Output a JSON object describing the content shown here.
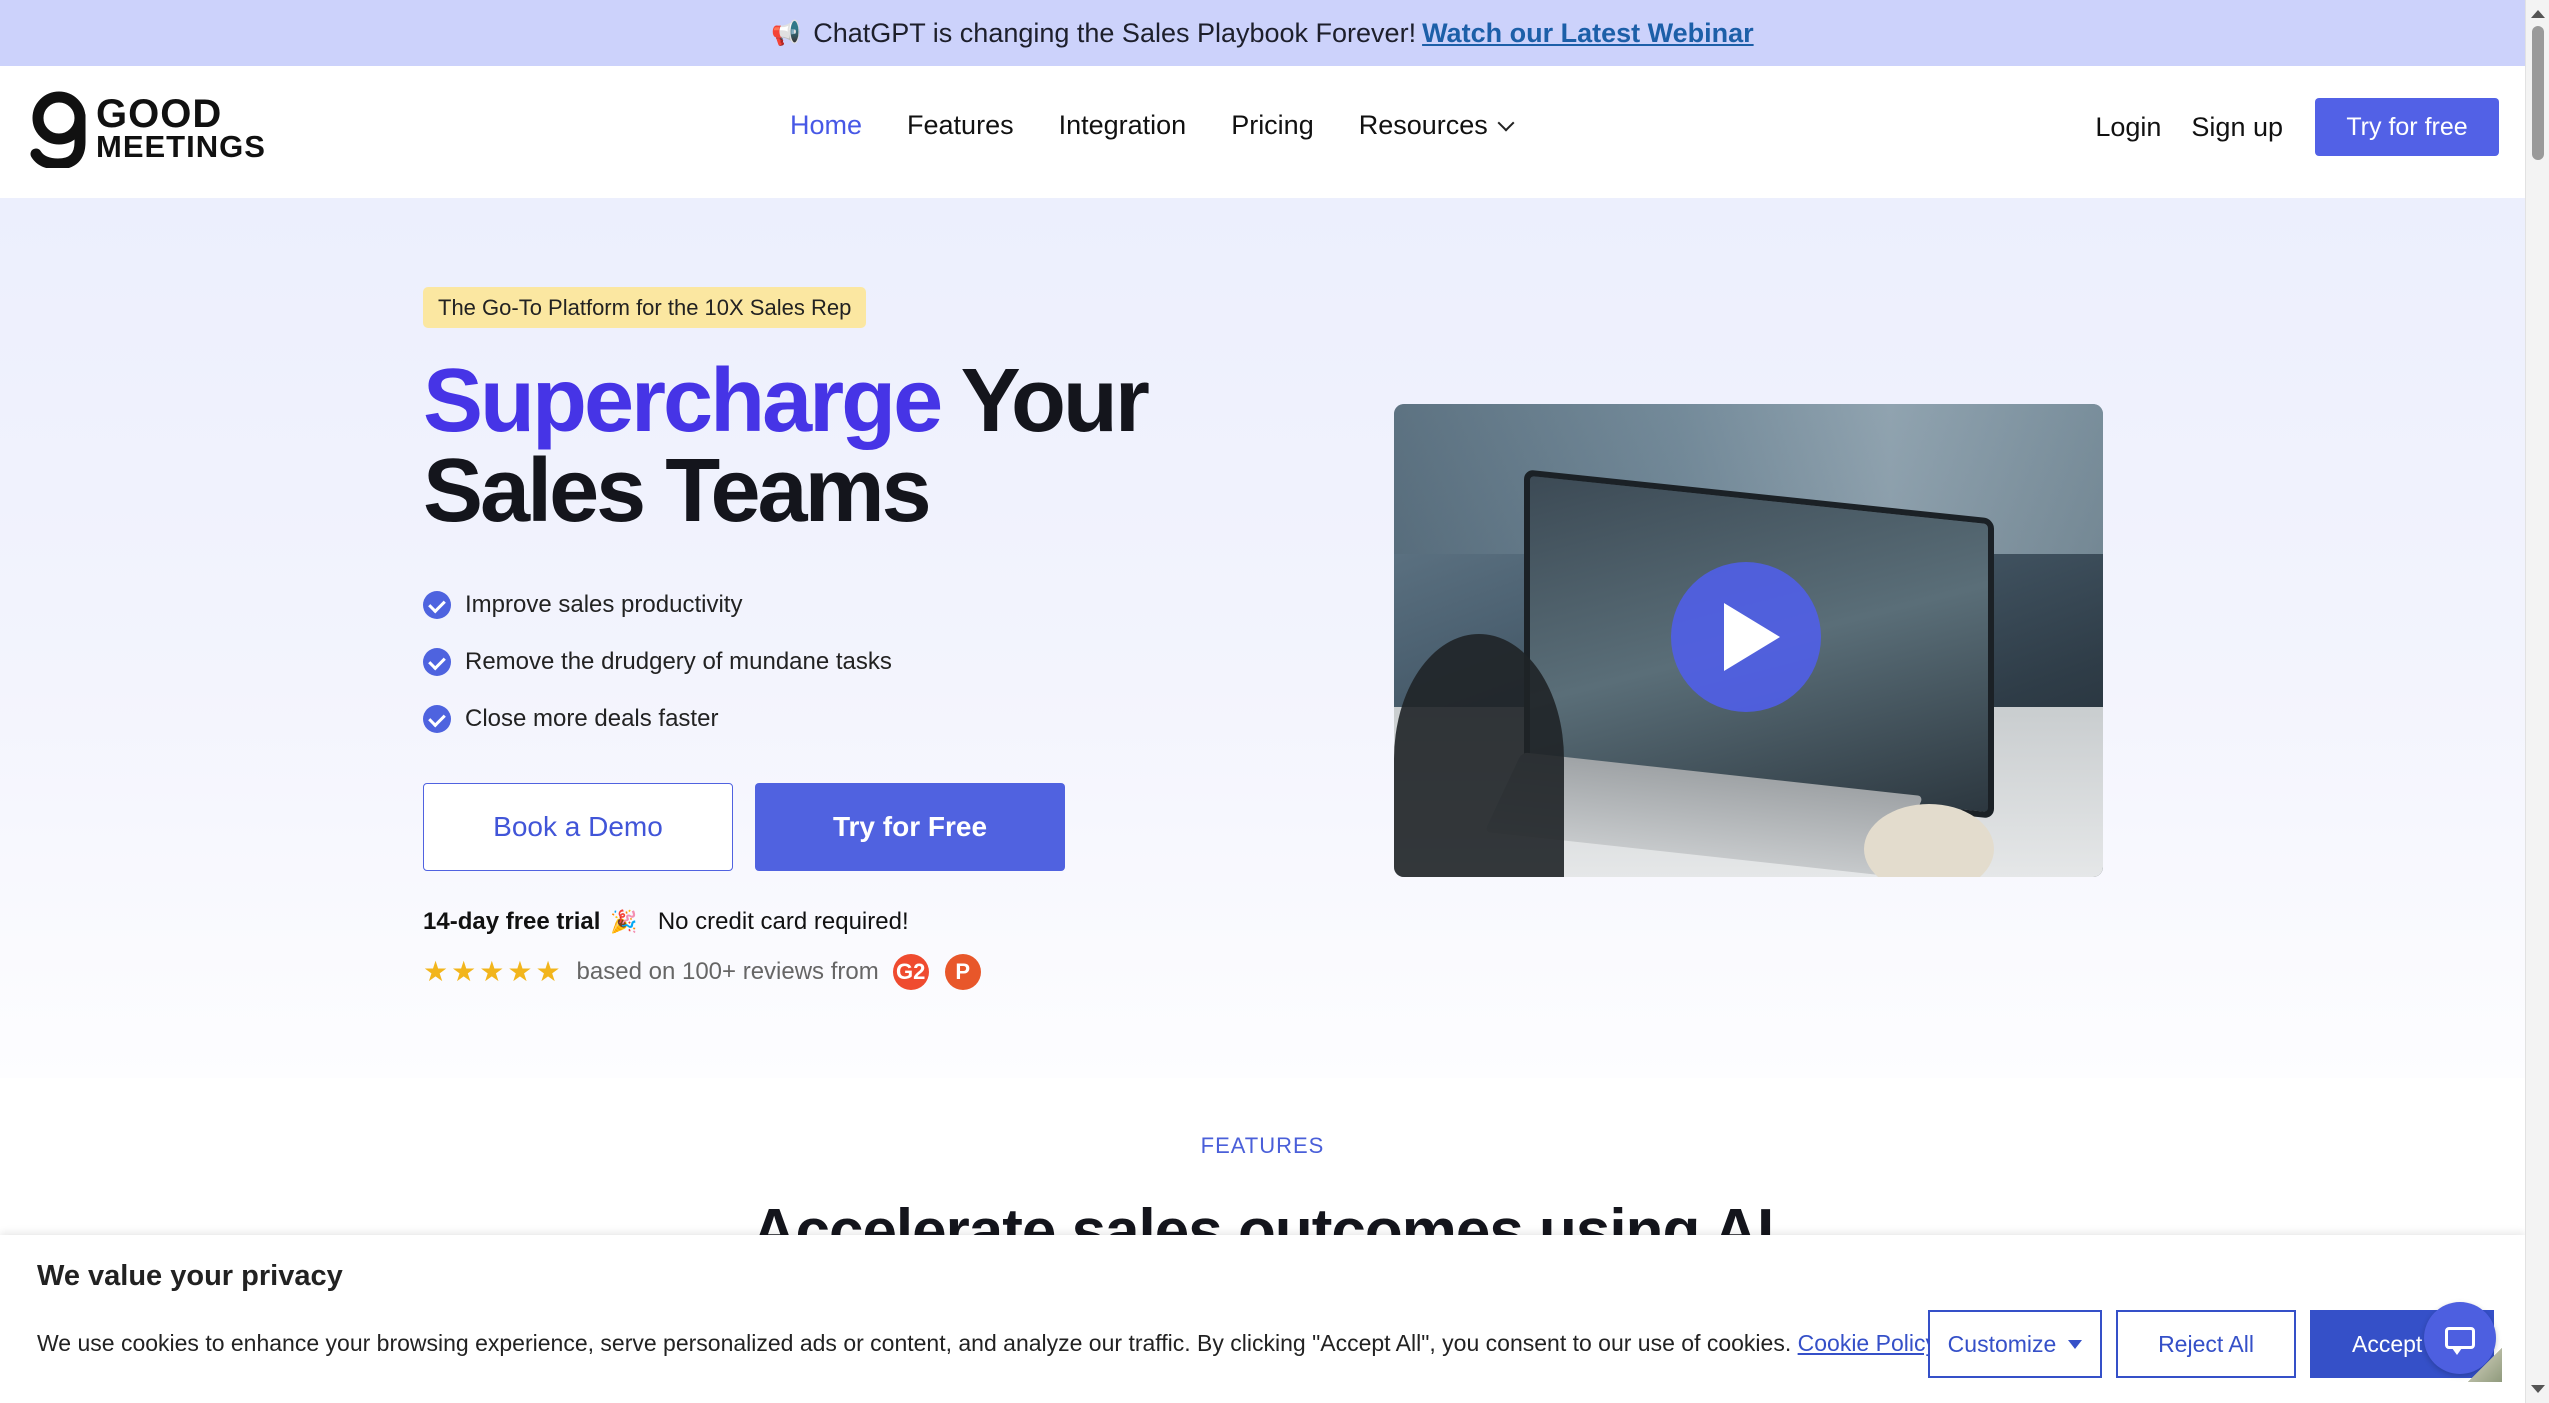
{
  "announcement": {
    "icon": "megaphone-icon",
    "text": "ChatGPT is changing the Sales Playbook Forever!",
    "link": "Watch our Latest Webinar"
  },
  "header": {
    "logo_line1": "GOOD",
    "logo_line2": "MEETINGS",
    "nav": [
      "Home",
      "Features",
      "Integration",
      "Pricing",
      "Resources"
    ],
    "login": "Login",
    "signup": "Sign up",
    "try_free": "Try for free"
  },
  "hero": {
    "tagline": "The Go-To Platform for the 10X Sales Rep",
    "headline_accent": "Supercharge",
    "headline_rest_line1": "Your",
    "headline_line2": "Sales Teams",
    "bullets": [
      "Improve sales productivity",
      "Remove the drudgery of mundane tasks",
      "Close more deals faster"
    ],
    "book_demo": "Book a Demo",
    "try_for_free": "Try for Free",
    "trial_bold": "14-day free trial",
    "no_card": "No credit card required!",
    "rating_stars": 5,
    "reviews_text": "based on 100+ reviews from",
    "review_sources": [
      "G2",
      "P"
    ]
  },
  "features": {
    "label": "FEATURES",
    "title": "Accelerate sales outcomes using AI"
  },
  "cookie": {
    "title": "We value your privacy",
    "text": "We use cookies to enhance your browsing experience, serve personalized ads or content, and analyze our traffic. By clicking \"Accept All\", you consent to our use of cookies.",
    "policy_link": "Cookie Policy",
    "customize": "Customize",
    "reject": "Reject All",
    "accept": "Accept All"
  },
  "colors": {
    "accent": "#5062e0",
    "headline_accent": "#4634e6",
    "announcement_bg": "#ccd2fb",
    "tagline_bg": "#fbe7a1"
  }
}
